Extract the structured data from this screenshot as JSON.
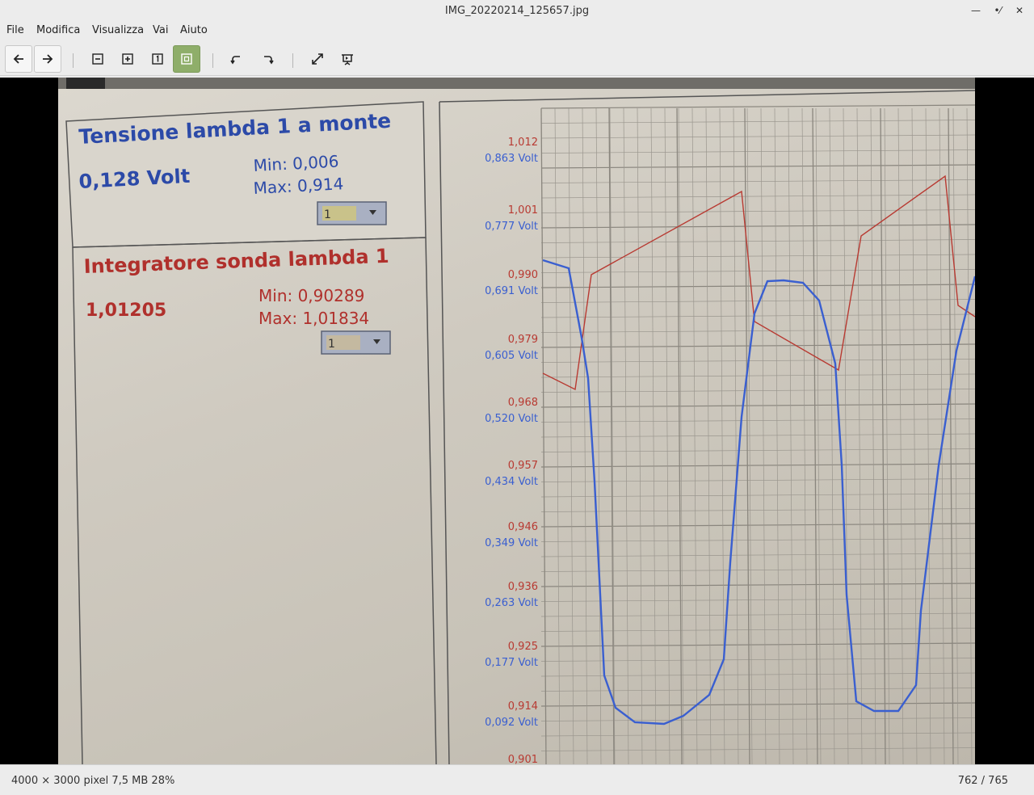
{
  "window": {
    "title": "IMG_20220214_125657.jpg"
  },
  "menu": [
    "File",
    "Modifica",
    "Visualizza",
    "Vai",
    "Aiuto"
  ],
  "toolbar": {
    "buttons": [
      "back-icon",
      "forward-icon",
      "zoom-out-icon",
      "zoom-in-icon",
      "zoom-normal-icon",
      "zoom-fit-icon",
      "rotate-left-icon",
      "rotate-right-icon",
      "fullscreen-icon",
      "slideshow-icon"
    ],
    "active": "zoom-fit-icon",
    "accent": "#8fae6a"
  },
  "photo": {
    "panel1": {
      "title": "Tensione lambda 1 a monte",
      "value": "0,128 Volt",
      "min": "Min: 0,006",
      "max": "Max: 0,914",
      "select": "1",
      "color": "#2c4aa8"
    },
    "panel2": {
      "title": "Integratore sonda lambda 1",
      "value": "1,01205",
      "min": "Min: 0,90289",
      "max": "Max: 1,01834",
      "select": "1",
      "color": "#b0302c"
    },
    "axis_labels": [
      {
        "red": "1,012",
        "blue": "0,863 Volt"
      },
      {
        "red": "1,001",
        "blue": "0,777 Volt"
      },
      {
        "red": "0,990",
        "blue": "0,691 Volt"
      },
      {
        "red": "0,979",
        "blue": "0,605 Volt"
      },
      {
        "red": "0,968",
        "blue": "0,520 Volt"
      },
      {
        "red": "0,957",
        "blue": "0,434 Volt"
      },
      {
        "red": "0,946",
        "blue": "0,349 Volt"
      },
      {
        "red": "0,936",
        "blue": "0,263 Volt"
      },
      {
        "red": "0,925",
        "blue": "0,177 Volt"
      },
      {
        "red": "0,914",
        "blue": "0,092 Volt"
      },
      {
        "red": "0,901",
        "blue": ""
      }
    ],
    "series_colors": {
      "blue": "#3a5fd0",
      "red": "#b83a32"
    }
  },
  "status": {
    "left": "4000 × 3000 pixel  7,5 MB   28%",
    "right": "762 / 765"
  }
}
